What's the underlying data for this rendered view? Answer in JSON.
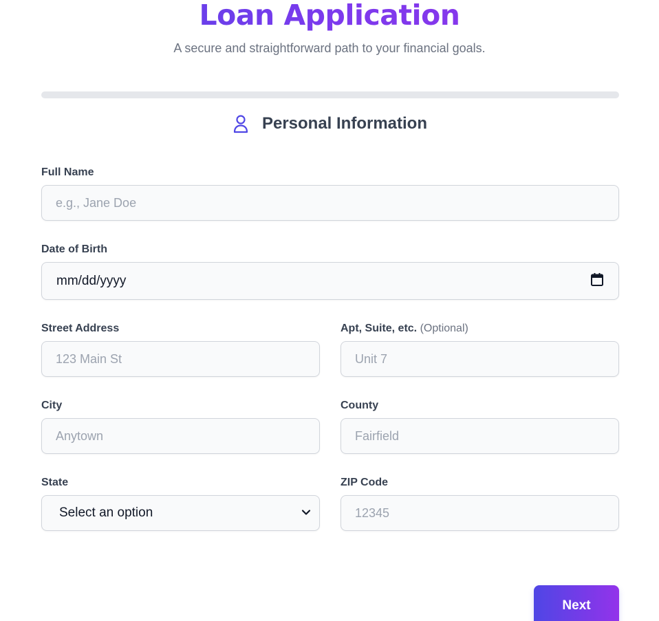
{
  "header": {
    "title": "Loan Application",
    "subtitle": "A secure and straightforward path to your financial goals."
  },
  "progress": {
    "percent": 0
  },
  "section": {
    "icon": "user-icon",
    "title": "Personal Information"
  },
  "form": {
    "full_name": {
      "label": "Full Name",
      "placeholder": "e.g., Jane Doe",
      "value": ""
    },
    "date_of_birth": {
      "label": "Date of Birth",
      "display": "mm/dd/yyyy",
      "icon": "calendar-icon"
    },
    "street_address": {
      "label": "Street Address",
      "placeholder": "123 Main St",
      "value": ""
    },
    "apt": {
      "label": "Apt, Suite, etc.",
      "optional_label": "(Optional)",
      "placeholder": "Unit 7",
      "value": ""
    },
    "city": {
      "label": "City",
      "placeholder": "Anytown",
      "value": ""
    },
    "county": {
      "label": "County",
      "placeholder": "Fairfield",
      "value": ""
    },
    "state": {
      "label": "State",
      "selected": "Select an option",
      "icon": "chevron-down-icon"
    },
    "zip": {
      "label": "ZIP Code",
      "placeholder": "12345",
      "value": ""
    }
  },
  "actions": {
    "next_label": "Next"
  },
  "colors": {
    "accent_start": "#4f46e5",
    "accent_end": "#9333ea",
    "input_bg": "#f9fafb",
    "input_border": "#d1d5db",
    "progress_track": "#e5e7eb"
  }
}
